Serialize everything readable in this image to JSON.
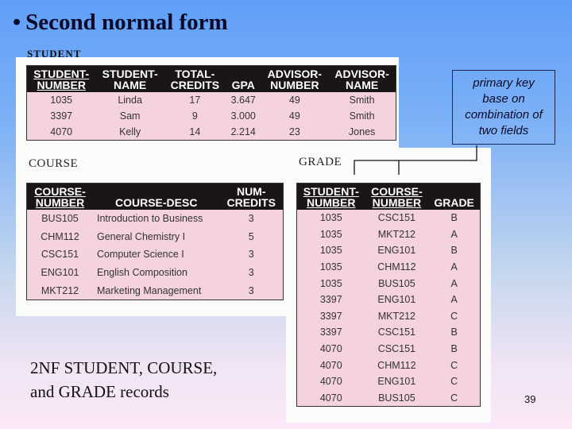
{
  "slide": {
    "bullet": "•",
    "title": "Second normal form",
    "caption_line1": "2NF STUDENT, COURSE,",
    "caption_line2": "and GRADE records",
    "page_number": "39"
  },
  "note": {
    "lines": [
      "primary key",
      "base on",
      "combination of",
      "two fields"
    ]
  },
  "student": {
    "label": "STUDENT",
    "headers": [
      {
        "line1": "STUDENT-",
        "line2": "NUMBER",
        "key": true
      },
      {
        "line1": "STUDENT-",
        "line2": "NAME",
        "key": false
      },
      {
        "line1": "TOTAL-",
        "line2": "CREDITS",
        "key": false
      },
      {
        "line1": "",
        "line2": "GPA",
        "key": false
      },
      {
        "line1": "ADVISOR-",
        "line2": "NUMBER",
        "key": false
      },
      {
        "line1": "ADVISOR-",
        "line2": "NAME",
        "key": false
      }
    ],
    "rows": [
      [
        "1035",
        "Linda",
        "17",
        "3.647",
        "49",
        "Smith"
      ],
      [
        "3397",
        "Sam",
        "9",
        "3.000",
        "49",
        "Smith"
      ],
      [
        "4070",
        "Kelly",
        "14",
        "2.214",
        "23",
        "Jones"
      ]
    ]
  },
  "course": {
    "label": "COURSE",
    "headers": [
      {
        "line1": "COURSE-",
        "line2": "NUMBER",
        "key": true
      },
      {
        "line1": "",
        "line2": "COURSE-DESC",
        "key": false
      },
      {
        "line1": "NUM-",
        "line2": "CREDITS",
        "key": false
      }
    ],
    "rows": [
      [
        "BUS105",
        "Introduction to Business",
        "3"
      ],
      [
        "CHM112",
        "General Chemistry I",
        "5"
      ],
      [
        "CSC151",
        "Computer Science I",
        "3"
      ],
      [
        "ENG101",
        "English Composition",
        "3"
      ],
      [
        "MKT212",
        "Marketing Management",
        "3"
      ]
    ]
  },
  "grade": {
    "label": "GRADE",
    "headers": [
      {
        "line1": "STUDENT-",
        "line2": "NUMBER",
        "key": true
      },
      {
        "line1": "COURSE-",
        "line2": "NUMBER",
        "key": true
      },
      {
        "line1": "",
        "line2": "GRADE",
        "key": false
      }
    ],
    "rows": [
      [
        "1035",
        "CSC151",
        "B"
      ],
      [
        "1035",
        "MKT212",
        "A"
      ],
      [
        "1035",
        "ENG101",
        "B"
      ],
      [
        "1035",
        "CHM112",
        "A"
      ],
      [
        "1035",
        "BUS105",
        "A"
      ],
      [
        "3397",
        "ENG101",
        "A"
      ],
      [
        "3397",
        "MKT212",
        "C"
      ],
      [
        "3397",
        "CSC151",
        "B"
      ],
      [
        "4070",
        "CSC151",
        "B"
      ],
      [
        "4070",
        "CHM112",
        "C"
      ],
      [
        "4070",
        "ENG101",
        "C"
      ],
      [
        "4070",
        "BUS105",
        "C"
      ]
    ]
  }
}
